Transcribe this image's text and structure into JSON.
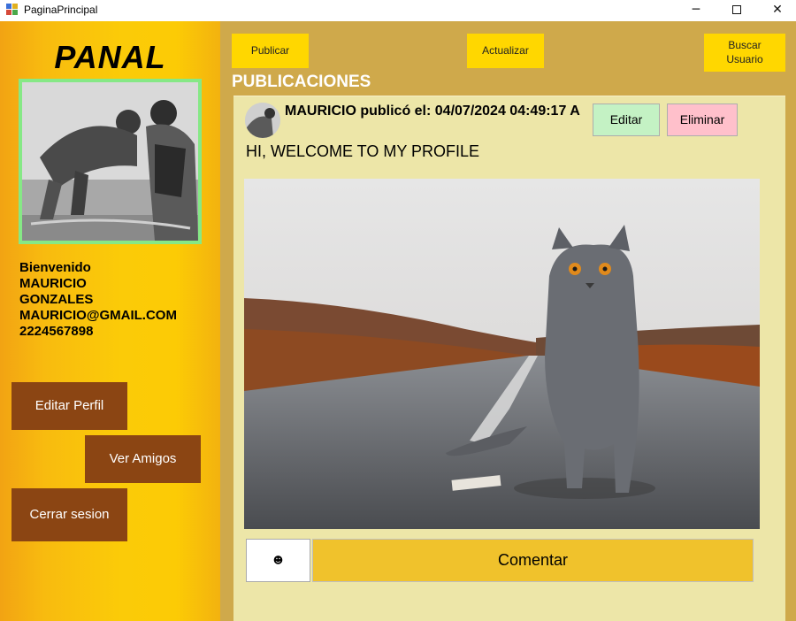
{
  "window": {
    "title": "PaginaPrincipal",
    "minimize": "─",
    "close": "✕",
    "icon": "app-icon"
  },
  "sidebar": {
    "brand": "PANAL",
    "profile_photo": "profile-photo (grayscale, two soldiers doing push-ups)",
    "welcome": "Bienvenido",
    "first_name": "MAURICIO",
    "last_name": "GONZALES",
    "email": "MAURICIO@GMAIL.COM",
    "phone": "2224567898",
    "buttons": {
      "edit_profile": "Editar Perfil",
      "view_friends": "Ver Amigos",
      "logout": "Cerrar sesion"
    }
  },
  "toolbar": {
    "publish": "Publicar",
    "refresh": "Actualizar",
    "search_user_line1": "Buscar",
    "search_user_line2": "Usuario"
  },
  "feed": {
    "title": "PUBLICACIONES",
    "post": {
      "header": "MAURICIO publicó el: 04/07/2024 04:49:17 A",
      "edit": "Editar",
      "delete": "Eliminar",
      "text": "HI, WELCOME TO MY PROFILE",
      "image": "post-image (grey cat on a road)",
      "emoji": "☻",
      "comment": "Comentar"
    }
  },
  "colors": {
    "sidebar": "#fbcb08",
    "main": "#cfa94b",
    "feed": "#ede6a8",
    "side_button": "#8b4513",
    "top_button": "#ffd700",
    "comment_button": "#f0c22c"
  }
}
